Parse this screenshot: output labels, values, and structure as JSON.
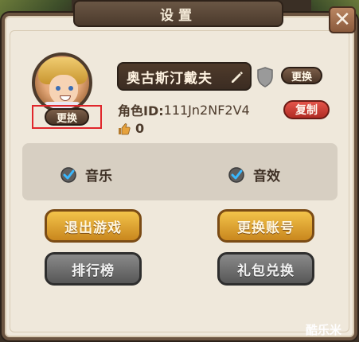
{
  "title": "设置",
  "close_label": "✕",
  "profile": {
    "change_avatar_label": "更换",
    "name": "奥古斯汀戴夫",
    "change_name_label": "更换",
    "role_id_label": "角色ID:",
    "role_id_value": "111Jn2NF2V4",
    "copy_label": "复制",
    "likes": "0"
  },
  "settings": {
    "music_label": "音乐",
    "sfx_label": "音效"
  },
  "buttons": {
    "exit": "退出游戏",
    "switch_account": "更换账号",
    "ranking": "排行榜",
    "gift_redeem": "礼包兑换"
  },
  "watermark": "酷乐米",
  "colors": {
    "accent_gold": "#c9871e",
    "danger_red": "#b12c24",
    "panel_bg": "#efe8db"
  }
}
